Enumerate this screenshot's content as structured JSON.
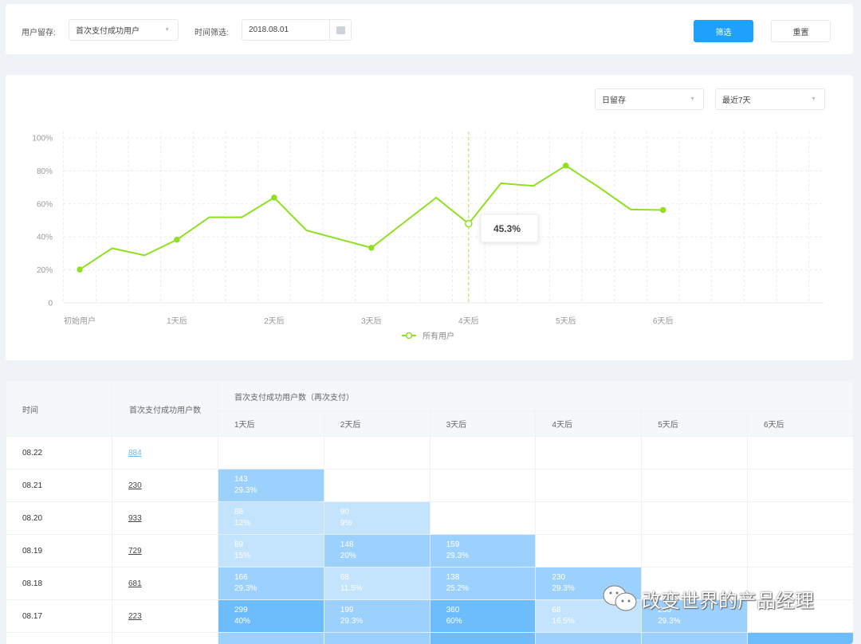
{
  "filters": {
    "retention_label": "用户留存:",
    "retention_value": "首次支付成功用户",
    "time_label": "时间筛选:",
    "date_value": "2018.08.01",
    "filter_button": "筛选",
    "reset_button": "重置"
  },
  "chart_controls": {
    "period": "日留存",
    "range": "最近7天"
  },
  "chart_data": {
    "type": "line",
    "y_ticks": [
      "0",
      "20%",
      "40%",
      "60%",
      "80%",
      "100%"
    ],
    "ylim": [
      0,
      100
    ],
    "x_range": [
      0,
      18
    ],
    "x_tick_labels": [
      {
        "i": 0,
        "label": "初始用户"
      },
      {
        "i": 3,
        "label": "1天后"
      },
      {
        "i": 6,
        "label": "2天后"
      },
      {
        "i": 9,
        "label": "3天后"
      },
      {
        "i": 12,
        "label": "4天后"
      },
      {
        "i": 15,
        "label": "5天后"
      },
      {
        "i": 18,
        "label": "6天后"
      }
    ],
    "series": [
      {
        "name": "所有用户",
        "color": "#8fe01f",
        "points": [
          [
            0,
            20.2
          ],
          [
            1,
            33.1
          ],
          [
            2,
            28.8
          ],
          [
            3,
            38.3
          ],
          [
            4,
            51.9
          ],
          [
            5,
            51.9
          ],
          [
            6,
            63.8
          ],
          [
            7,
            43.9
          ],
          [
            9,
            33.4
          ],
          [
            11,
            63.8
          ],
          [
            12,
            48
          ],
          [
            13,
            72.5
          ],
          [
            14,
            70.9
          ],
          [
            15,
            83.2
          ],
          [
            16,
            70.4
          ],
          [
            17,
            56.6
          ],
          [
            18,
            56.3
          ]
        ],
        "markers": [
          0,
          3,
          6,
          9,
          12,
          15,
          18
        ]
      }
    ],
    "hover": {
      "i": 12,
      "tooltip": "45.3%"
    },
    "legend": "bottom-center",
    "grid": true
  },
  "table": {
    "headers": {
      "time": "时间",
      "users": "首次支付成功用户数",
      "group": "首次支付成功用户数（再次支付）",
      "days": [
        "1天后",
        "2天后",
        "3天后",
        "4天后",
        "5天后",
        "6天后"
      ]
    },
    "rows": [
      {
        "date": "08.22",
        "users": "884",
        "cells": []
      },
      {
        "date": "08.21",
        "users": "230",
        "cells": [
          {
            "n": "143",
            "p": "29.3%",
            "s": "m"
          }
        ]
      },
      {
        "date": "08.20",
        "users": "933",
        "cells": [
          {
            "n": "88",
            "p": "12%",
            "s": "l"
          },
          {
            "n": "90",
            "p": "9%",
            "s": "l"
          }
        ]
      },
      {
        "date": "08.19",
        "users": "729",
        "cells": [
          {
            "n": "89",
            "p": "15%",
            "s": "l"
          },
          {
            "n": "148",
            "p": "20%",
            "s": "m"
          },
          {
            "n": "159",
            "p": "29.3%",
            "s": "m"
          }
        ]
      },
      {
        "date": "08.18",
        "users": "681",
        "cells": [
          {
            "n": "166",
            "p": "29.3%",
            "s": "m"
          },
          {
            "n": "68",
            "p": "11.5%",
            "s": "l"
          },
          {
            "n": "138",
            "p": "25.2%",
            "s": "m"
          },
          {
            "n": "230",
            "p": "29.3%",
            "s": "m"
          }
        ]
      },
      {
        "date": "08.17",
        "users": "223",
        "cells": [
          {
            "n": "299",
            "p": "40%",
            "s": "d"
          },
          {
            "n": "199",
            "p": "29.3%",
            "s": "m"
          },
          {
            "n": "360",
            "p": "60%",
            "s": "d"
          },
          {
            "n": "68",
            "p": "16.5%",
            "s": "l"
          },
          {
            "n": "230",
            "p": "29.3%",
            "s": "m"
          }
        ]
      },
      {
        "date": "",
        "users": "",
        "cells": [
          {
            "n": "",
            "p": "",
            "s": "m"
          },
          {
            "n": "",
            "p": "",
            "s": "m"
          },
          {
            "n": "",
            "p": "",
            "s": "d"
          },
          {
            "n": "",
            "p": "",
            "s": "m"
          },
          {
            "n": "",
            "p": "",
            "s": "m"
          },
          {
            "n": "",
            "p": "",
            "s": "d"
          }
        ]
      }
    ]
  },
  "watermark": "改变世界的产品经理"
}
